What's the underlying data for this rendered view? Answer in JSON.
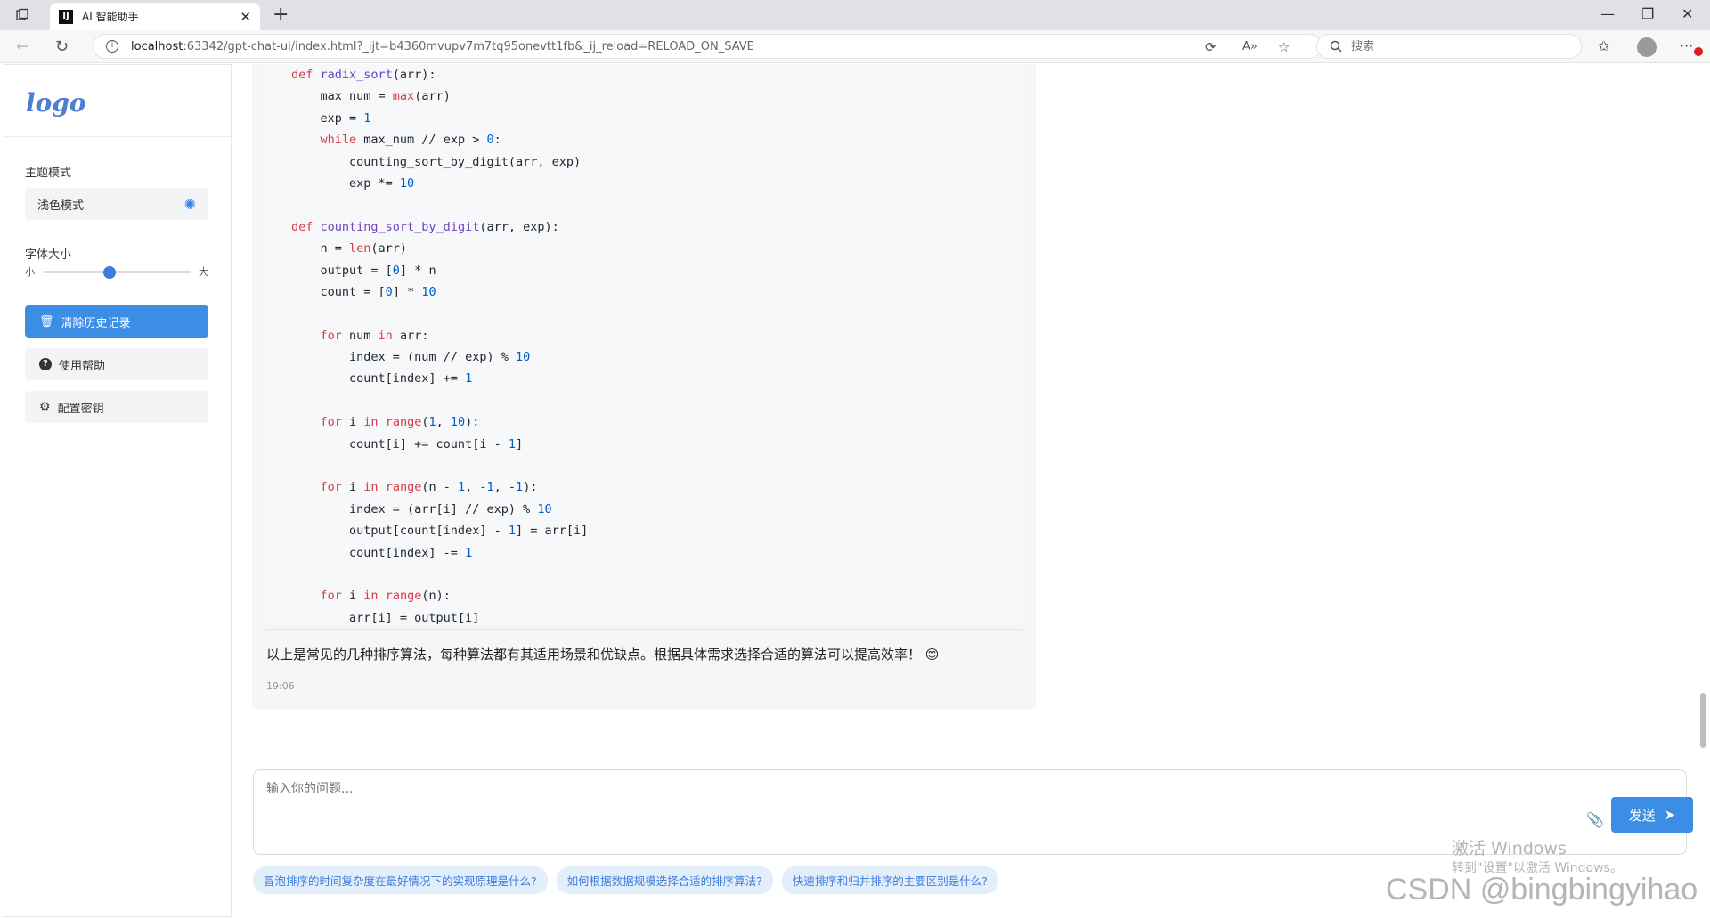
{
  "browser": {
    "tab_title": "AI 智能助手",
    "tab_favicon": "IJ",
    "url_host": "localhost",
    "url_rest": ":63342/gpt-chat-ui/index.html?_ijt=b4360mvupv7m7tq95onevtt1fb&_ij_reload=RELOAD_ON_SAVE",
    "search_placeholder": "搜索"
  },
  "sidebar": {
    "logo": "logo",
    "theme_label": "主题模式",
    "theme_value": "浅色模式",
    "font_label": "字体大小",
    "font_small": "小",
    "font_large": "大",
    "font_size_fraction": 0.45,
    "clear_button": "清除历史记录",
    "help_button": "使用帮助",
    "key_button": "配置密钥"
  },
  "chat": {
    "code_lines": [
      [
        {
          "t": "def ",
          "c": "kw"
        },
        {
          "t": "radix_sort",
          "c": "fn"
        },
        {
          "t": "(arr):",
          "c": ""
        }
      ],
      [
        {
          "t": "    max_num = ",
          "c": ""
        },
        {
          "t": "max",
          "c": "kw"
        },
        {
          "t": "(arr)",
          "c": ""
        }
      ],
      [
        {
          "t": "    exp = ",
          "c": ""
        },
        {
          "t": "1",
          "c": "num"
        }
      ],
      [
        {
          "t": "    ",
          "c": ""
        },
        {
          "t": "while",
          "c": "kw"
        },
        {
          "t": " max_num // exp > ",
          "c": ""
        },
        {
          "t": "0",
          "c": "num"
        },
        {
          "t": ":",
          "c": ""
        }
      ],
      [
        {
          "t": "        counting_sort_by_digit(arr, exp)",
          "c": ""
        }
      ],
      [
        {
          "t": "        exp *= ",
          "c": ""
        },
        {
          "t": "10",
          "c": "num"
        }
      ],
      [],
      [
        {
          "t": "def ",
          "c": "kw"
        },
        {
          "t": "counting_sort_by_digit",
          "c": "fn"
        },
        {
          "t": "(arr, exp):",
          "c": ""
        }
      ],
      [
        {
          "t": "    n = ",
          "c": ""
        },
        {
          "t": "len",
          "c": "kw"
        },
        {
          "t": "(arr)",
          "c": ""
        }
      ],
      [
        {
          "t": "    output = [",
          "c": ""
        },
        {
          "t": "0",
          "c": "num"
        },
        {
          "t": "] * n",
          "c": ""
        }
      ],
      [
        {
          "t": "    count = [",
          "c": ""
        },
        {
          "t": "0",
          "c": "num"
        },
        {
          "t": "] * ",
          "c": ""
        },
        {
          "t": "10",
          "c": "num"
        }
      ],
      [],
      [
        {
          "t": "    ",
          "c": ""
        },
        {
          "t": "for",
          "c": "kw"
        },
        {
          "t": " num ",
          "c": ""
        },
        {
          "t": "in",
          "c": "kw"
        },
        {
          "t": " arr:",
          "c": ""
        }
      ],
      [
        {
          "t": "        index = (num // exp) % ",
          "c": ""
        },
        {
          "t": "10",
          "c": "num"
        }
      ],
      [
        {
          "t": "        count[index] += ",
          "c": ""
        },
        {
          "t": "1",
          "c": "num"
        }
      ],
      [],
      [
        {
          "t": "    ",
          "c": ""
        },
        {
          "t": "for",
          "c": "kw"
        },
        {
          "t": " i ",
          "c": ""
        },
        {
          "t": "in",
          "c": "kw"
        },
        {
          "t": " ",
          "c": ""
        },
        {
          "t": "range",
          "c": "kw"
        },
        {
          "t": "(",
          "c": ""
        },
        {
          "t": "1",
          "c": "num"
        },
        {
          "t": ", ",
          "c": ""
        },
        {
          "t": "10",
          "c": "num"
        },
        {
          "t": "):",
          "c": ""
        }
      ],
      [
        {
          "t": "        count[i] += count[i - ",
          "c": ""
        },
        {
          "t": "1",
          "c": "num"
        },
        {
          "t": "]",
          "c": ""
        }
      ],
      [],
      [
        {
          "t": "    ",
          "c": ""
        },
        {
          "t": "for",
          "c": "kw"
        },
        {
          "t": " i ",
          "c": ""
        },
        {
          "t": "in",
          "c": "kw"
        },
        {
          "t": " ",
          "c": ""
        },
        {
          "t": "range",
          "c": "kw"
        },
        {
          "t": "(n - ",
          "c": ""
        },
        {
          "t": "1",
          "c": "num"
        },
        {
          "t": ", -",
          "c": ""
        },
        {
          "t": "1",
          "c": "num"
        },
        {
          "t": ", -",
          "c": ""
        },
        {
          "t": "1",
          "c": "num"
        },
        {
          "t": "):",
          "c": ""
        }
      ],
      [
        {
          "t": "        index = (arr[i] // exp) % ",
          "c": ""
        },
        {
          "t": "10",
          "c": "num"
        }
      ],
      [
        {
          "t": "        output[count[index] - ",
          "c": ""
        },
        {
          "t": "1",
          "c": "num"
        },
        {
          "t": "] = arr[i]",
          "c": ""
        }
      ],
      [
        {
          "t": "        count[index] -= ",
          "c": ""
        },
        {
          "t": "1",
          "c": "num"
        }
      ],
      [],
      [
        {
          "t": "    ",
          "c": ""
        },
        {
          "t": "for",
          "c": "kw"
        },
        {
          "t": " i ",
          "c": ""
        },
        {
          "t": "in",
          "c": "kw"
        },
        {
          "t": " ",
          "c": ""
        },
        {
          "t": "range",
          "c": "kw"
        },
        {
          "t": "(n):",
          "c": ""
        }
      ],
      [
        {
          "t": "        arr[i] = output[i]",
          "c": ""
        }
      ]
    ],
    "message_text": "以上是常见的几种排序算法，每种算法都有其适用场景和优缺点。根据具体需求选择合适的算法可以提高效率！ 😊",
    "message_time": "19:06"
  },
  "composer": {
    "placeholder": "输入你的问题...",
    "send_label": "发送",
    "suggestions": [
      "冒泡排序的时间复杂度在最好情况下的实现原理是什么?",
      "如何根据数据规模选择合适的排序算法?",
      "快速排序和归并排序的主要区别是什么?"
    ]
  },
  "overlay": {
    "activate_title": "激活 Windows",
    "activate_sub": "转到\"设置\"以激活 Windows。",
    "csdn_watermark": "CSDN @bingbingyihao"
  },
  "colors": {
    "accent": "#3b8de6",
    "keyword": "#d73a49",
    "function": "#6f42c1",
    "number": "#005cc5"
  }
}
